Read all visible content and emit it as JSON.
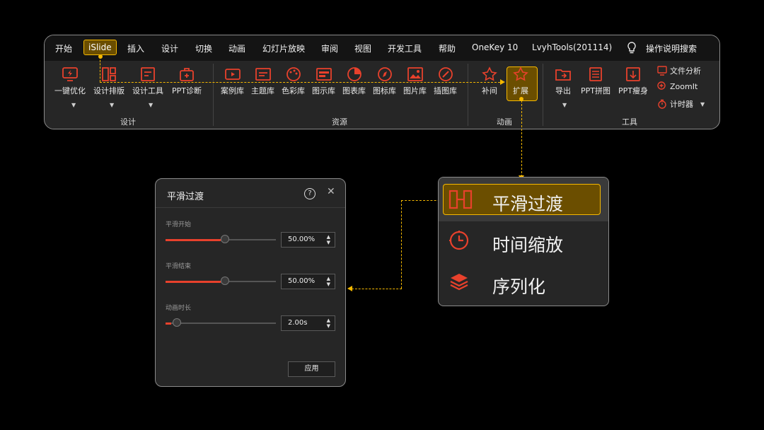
{
  "tabs": [
    "开始",
    "iSlide",
    "插入",
    "设计",
    "切换",
    "动画",
    "幻灯片放映",
    "审阅",
    "视图",
    "开发工具",
    "帮助",
    "OneKey 10",
    "LvyhTools(201114)",
    "操作说明搜索"
  ],
  "groups": {
    "design": {
      "label": "设计",
      "buttons": [
        "一键优化",
        "设计排版",
        "设计工具",
        "PPT诊断"
      ]
    },
    "resources": {
      "label": "资源",
      "buttons": [
        "案例库",
        "主题库",
        "色彩库",
        "图示库",
        "图表库",
        "图标库",
        "图片库",
        "插图库"
      ]
    },
    "animation": {
      "label": "动画",
      "buttons": [
        "补间",
        "扩展"
      ]
    },
    "tools": {
      "label": "工具",
      "buttons": [
        "导出",
        "PPT拼图",
        "PPT瘦身"
      ],
      "small": [
        "文件分析",
        "ZoomIt",
        "计时器"
      ]
    }
  },
  "colors": {
    "accent": "#f5b800",
    "icon_red": "#e8412c",
    "panel": "#262626"
  },
  "dialog": {
    "title": "平滑过渡",
    "sliders": [
      {
        "label": "平滑开始",
        "value": "50.00%",
        "level": 0.5
      },
      {
        "label": "平滑结束",
        "value": "50.00%",
        "level": 0.5
      },
      {
        "label": "动画时长",
        "value": "2.00s",
        "level": 0.05
      }
    ],
    "apply": "应用"
  },
  "popup": {
    "items": [
      "平滑过渡",
      "时间缩放",
      "序列化"
    ],
    "selected": 0
  }
}
